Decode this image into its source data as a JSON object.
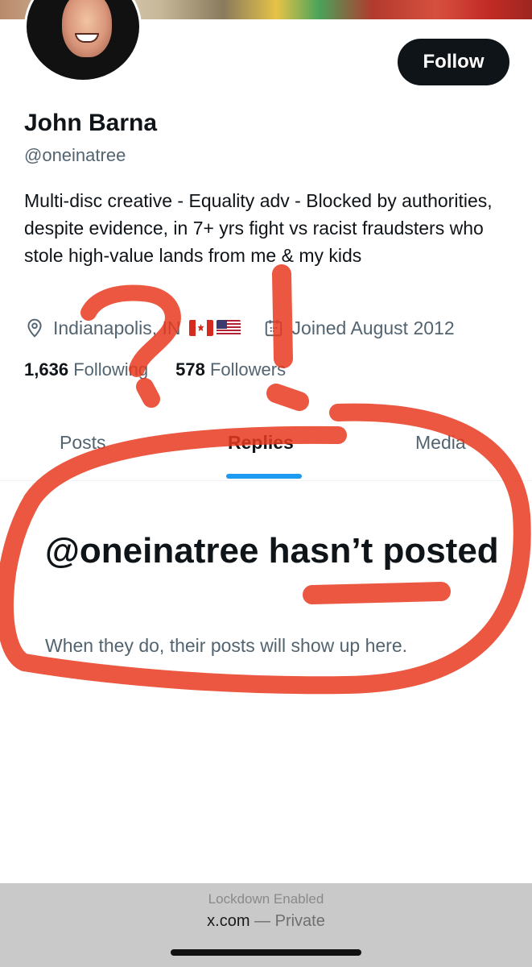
{
  "profile": {
    "display_name": "John Barna",
    "handle": "@oneinatree",
    "bio": "Multi-disc creative - Equality adv - Blocked by authorities, despite evidence, in 7+ yrs fight vs racist fraudsters who stole high-value lands from me & my kids",
    "location": "Indianapolis, IN",
    "joined": "Joined August 2012",
    "following_count": "1,636",
    "following_label": "Following",
    "followers_count": "578",
    "followers_label": "Followers",
    "follow_button": "Follow"
  },
  "tabs": [
    {
      "label": "Posts"
    },
    {
      "label": "Replies"
    },
    {
      "label": "Media"
    }
  ],
  "empty_state": {
    "title": "@oneinatree hasn’t posted",
    "subtitle": "When they do, their posts will show up here."
  },
  "browser": {
    "lockdown": "Lockdown Enabled",
    "domain": "x.com",
    "separator": "—",
    "mode": "Private"
  },
  "icons": {
    "location": "map-pin-icon",
    "calendar": "calendar-icon",
    "flags": [
      "canada-flag-icon",
      "usa-flag-icon"
    ]
  },
  "colors": {
    "accent": "#1d9bf0",
    "text_primary": "#0f1419",
    "text_secondary": "#536471",
    "annotation": "#e8391e"
  }
}
